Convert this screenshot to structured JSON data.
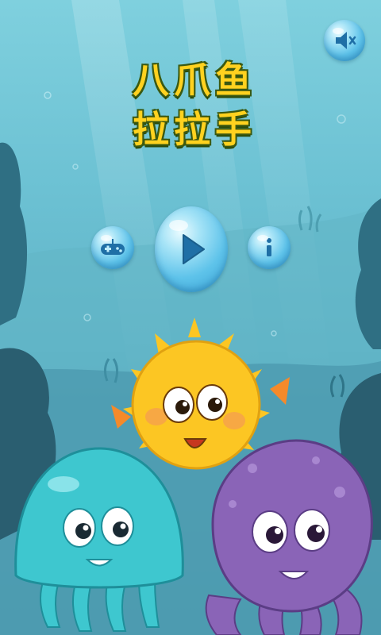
{
  "title": {
    "line1": "八爪鱼",
    "line2": "拉拉手"
  },
  "buttons": {
    "mute_icon": "speaker-muted-icon",
    "gamepad_icon": "gamepad-icon",
    "play_icon": "play-icon",
    "info_icon": "info-icon"
  },
  "characters": [
    "pufferfish",
    "jellyfish",
    "octopus"
  ],
  "colors": {
    "water_top": "#7fd0de",
    "water_bottom": "#3f8aa0",
    "title_yellow": "#ffd21f",
    "bubble_blue": "#5ec3ea",
    "pufferfish_yellow": "#fcc623",
    "jellyfish_teal": "#3ec7cf",
    "octopus_purple": "#8a64b7"
  }
}
